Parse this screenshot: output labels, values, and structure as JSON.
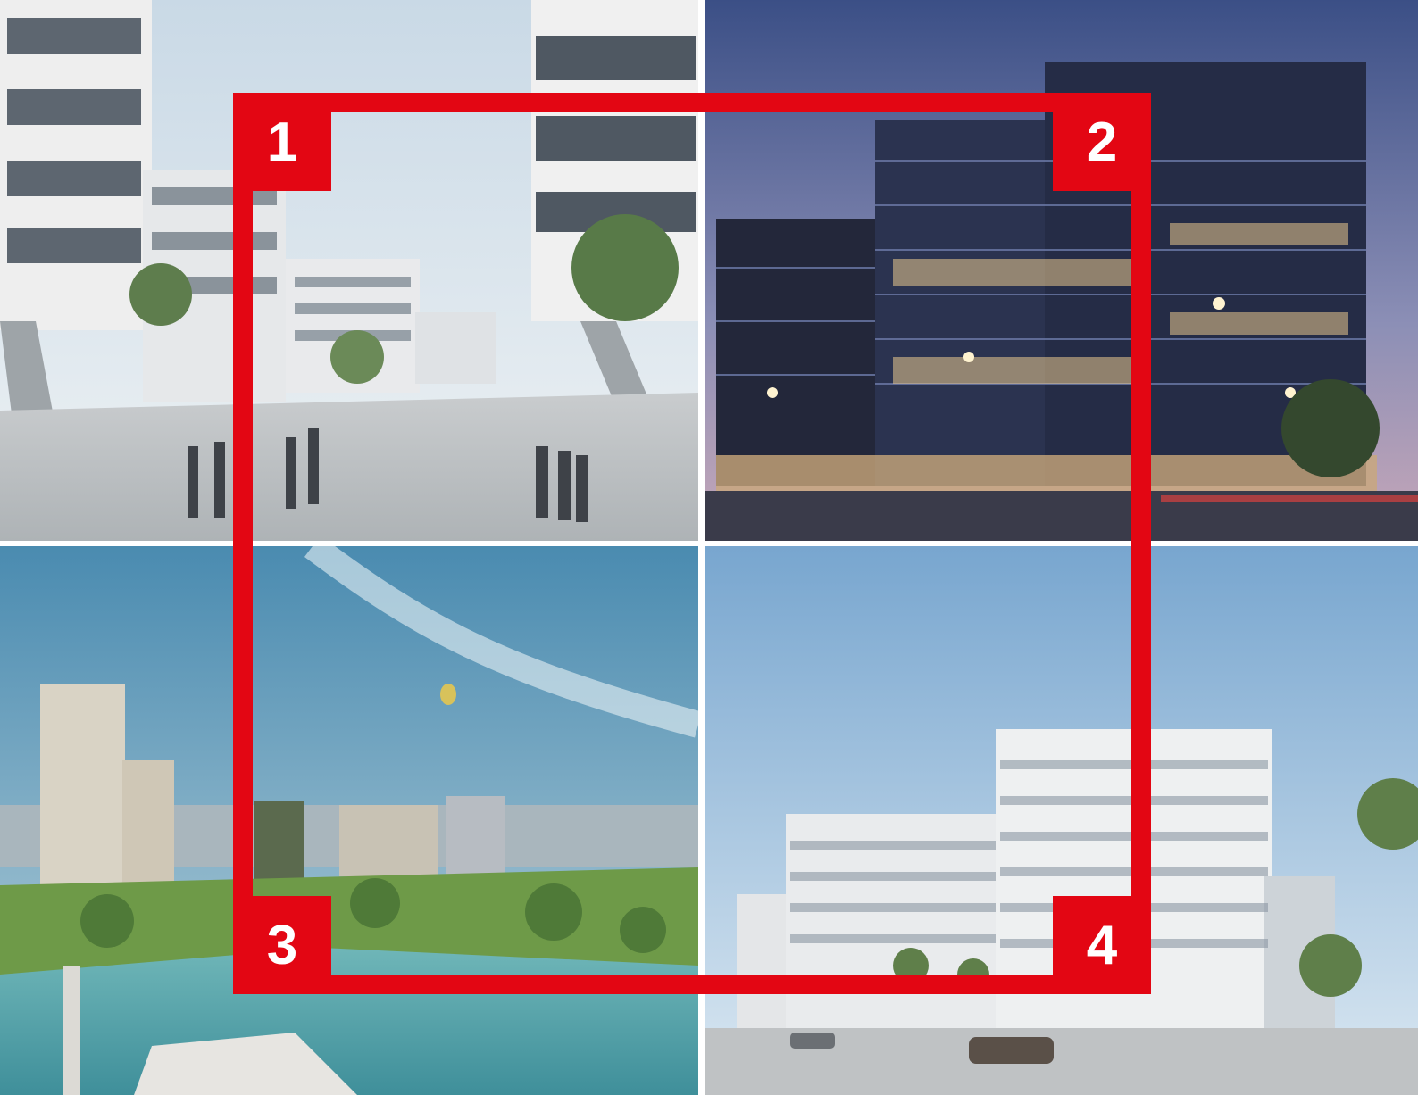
{
  "collage": {
    "tiles": [
      {
        "badge": "1",
        "description_icon": "pedestrian-plaza-photo"
      },
      {
        "badge": "2",
        "description_icon": "office-tower-night-photo"
      },
      {
        "badge": "3",
        "description_icon": "lakeside-city-aerial-photo"
      },
      {
        "badge": "4",
        "description_icon": "office-complex-street-photo"
      }
    ],
    "accent_color": "#e30613"
  }
}
